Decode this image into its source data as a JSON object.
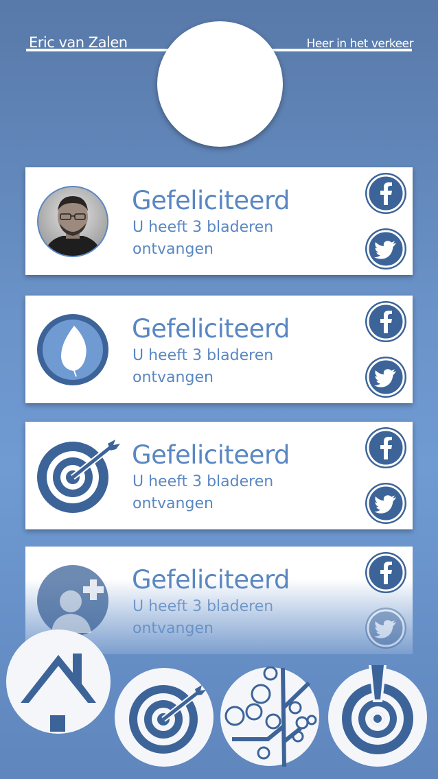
{
  "header": {
    "user_name": "Eric van Zalen",
    "user_status": "Heer in het verkeer"
  },
  "cards": [
    {
      "icon": "profile-photo",
      "title": "Gefeliciteerd",
      "message": "U heeft 3 bladeren ontvangen"
    },
    {
      "icon": "leaf-icon",
      "title": "Gefeliciteerd",
      "message": "U heeft 3 bladeren ontvangen"
    },
    {
      "icon": "target-icon",
      "title": "Gefeliciteerd",
      "message": "U heeft 3 bladeren ontvangen"
    },
    {
      "icon": "add-user-icon",
      "title": "Gefeliciteerd",
      "message": "U heeft 3 bladeren ontvangen"
    }
  ],
  "social": {
    "facebook_icon": "facebook-icon",
    "twitter_icon": "twitter-icon"
  },
  "nav": [
    "home-icon",
    "target-icon",
    "tree-icon",
    "alert-target-icon"
  ],
  "colors": {
    "accent": "#5a87c2",
    "icon_blue": "#3d6499",
    "background": "#6a93c9",
    "white": "#ffffff"
  }
}
